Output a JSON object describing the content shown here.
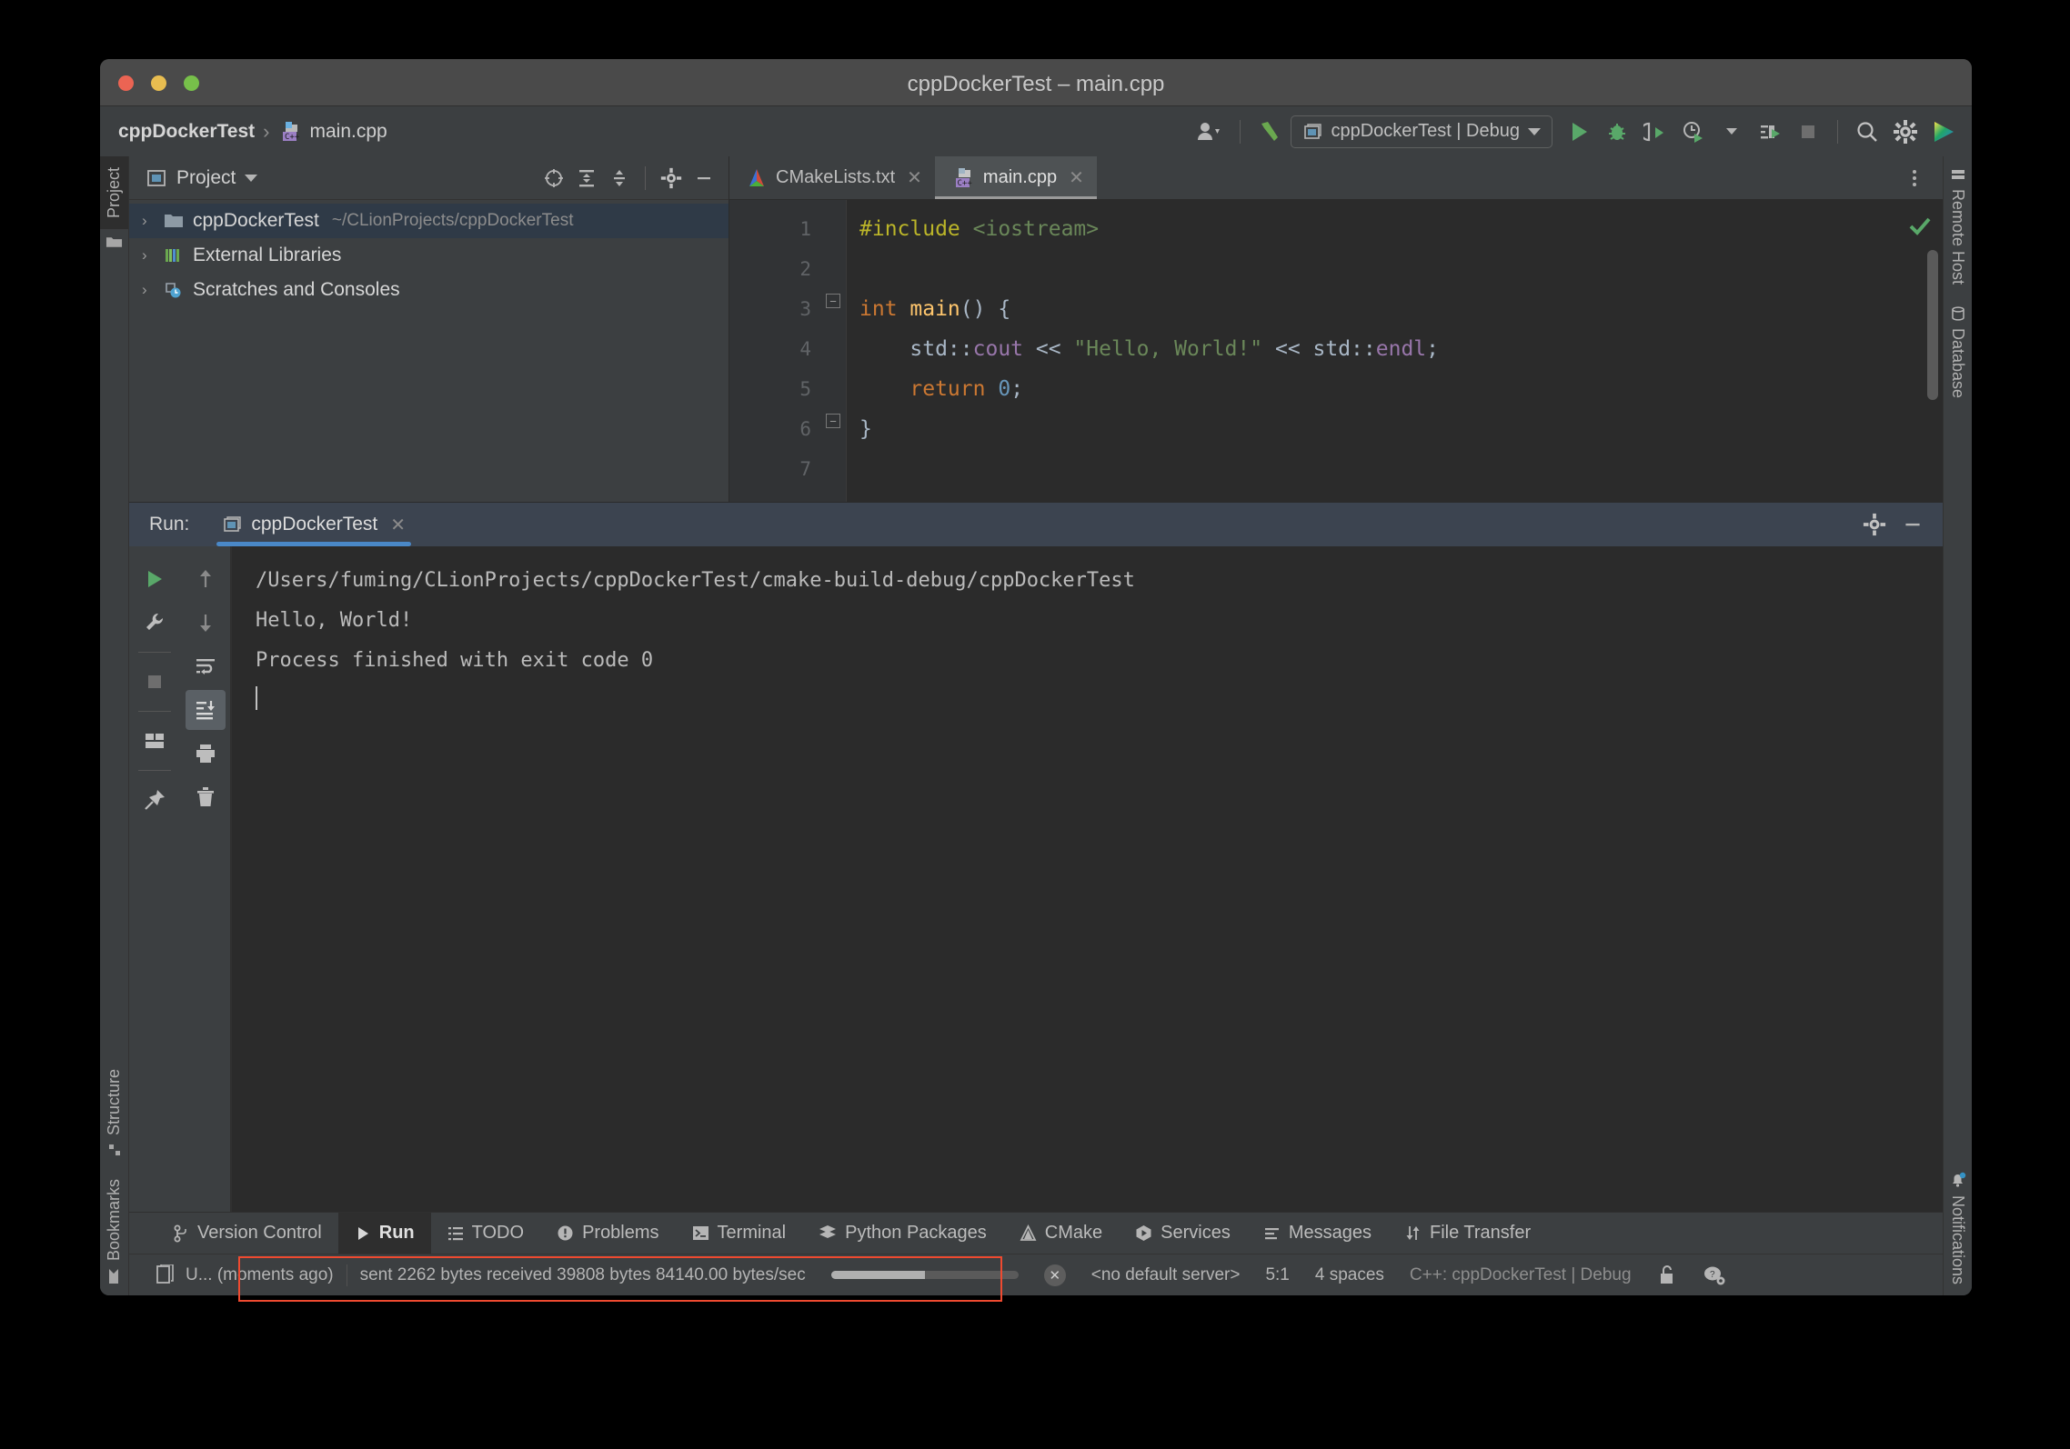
{
  "window": {
    "title": "cppDockerTest – main.cpp",
    "traffic_lights": [
      "close-red",
      "minimize-yellow",
      "maximize-green"
    ]
  },
  "navbar": {
    "breadcrumb": {
      "project": "cppDockerTest",
      "separator": "›",
      "file": "main.cpp"
    },
    "run_config": {
      "label": "cppDockerTest | Debug",
      "icon": "run-configuration-icon"
    },
    "buttons": [
      {
        "name": "user-account-icon",
        "label": ""
      },
      {
        "name": "build-hammer-icon",
        "label": ""
      },
      {
        "name": "run-icon",
        "label": ""
      },
      {
        "name": "debug-icon",
        "label": ""
      },
      {
        "name": "run-with-coverage-icon",
        "label": ""
      },
      {
        "name": "profile-icon",
        "label": ""
      },
      {
        "name": "attach-to-process-icon",
        "label": ""
      },
      {
        "name": "stop-icon",
        "label": ""
      },
      {
        "name": "search-icon",
        "label": ""
      },
      {
        "name": "settings-gear-icon",
        "label": ""
      },
      {
        "name": "ide-logo-icon",
        "label": ""
      }
    ]
  },
  "left_stripe": {
    "top": [
      {
        "label": "Project",
        "active": true
      }
    ],
    "bottom": [
      {
        "label": "Structure"
      },
      {
        "label": "Bookmarks"
      }
    ]
  },
  "right_stripe": {
    "top": [
      {
        "label": "Remote Host"
      },
      {
        "label": "Database"
      }
    ],
    "bottom": [
      {
        "label": "Notifications"
      }
    ]
  },
  "project_panel": {
    "title": "Project",
    "toolbar": [
      {
        "name": "select-opened-file-icon"
      },
      {
        "name": "expand-all-icon"
      },
      {
        "name": "collapse-all-icon"
      },
      {
        "name": "panel-settings-gear-icon"
      },
      {
        "name": "hide-panel-icon"
      }
    ],
    "tree": [
      {
        "label": "cppDockerTest",
        "path": "~/CLionProjects/cppDockerTest",
        "icon": "folder-icon",
        "selected": true,
        "expanded": false
      },
      {
        "label": "External Libraries",
        "path": "",
        "icon": "libraries-icon",
        "selected": false,
        "expanded": false
      },
      {
        "label": "Scratches and Consoles",
        "path": "",
        "icon": "scratches-icon",
        "selected": false,
        "expanded": false
      }
    ]
  },
  "editor": {
    "tabs": [
      {
        "label": "CMakeLists.txt",
        "icon": "cmake-icon",
        "active": false
      },
      {
        "label": "main.cpp",
        "icon": "cpp-file-icon",
        "active": true
      }
    ],
    "line_numbers": [
      "1",
      "2",
      "3",
      "4",
      "5",
      "6",
      "7"
    ],
    "code_lines": [
      {
        "n": 1,
        "tokens": [
          {
            "t": "#include",
            "c": "k-pre"
          },
          {
            "t": " ",
            "c": "k-txt"
          },
          {
            "t": "<iostream>",
            "c": "k-inc"
          }
        ]
      },
      {
        "n": 2,
        "tokens": []
      },
      {
        "n": 3,
        "tokens": [
          {
            "t": "int ",
            "c": "k-kw"
          },
          {
            "t": "main",
            "c": "k-fn"
          },
          {
            "t": "() {",
            "c": "k-txt"
          }
        ]
      },
      {
        "n": 4,
        "tokens": [
          {
            "t": "    std",
            "c": "k-txt"
          },
          {
            "t": "::",
            "c": "k-txt"
          },
          {
            "t": "cout",
            "c": "k-id"
          },
          {
            "t": " << ",
            "c": "k-txt"
          },
          {
            "t": "\"Hello, World!\"",
            "c": "k-str"
          },
          {
            "t": " << ",
            "c": "k-txt"
          },
          {
            "t": "std",
            "c": "k-txt"
          },
          {
            "t": "::",
            "c": "k-txt"
          },
          {
            "t": "endl",
            "c": "k-id"
          },
          {
            "t": ";",
            "c": "k-txt"
          }
        ]
      },
      {
        "n": 5,
        "tokens": [
          {
            "t": "    return ",
            "c": "k-kw"
          },
          {
            "t": "0",
            "c": "k-num"
          },
          {
            "t": ";",
            "c": "k-txt"
          }
        ]
      },
      {
        "n": 6,
        "tokens": [
          {
            "t": "}",
            "c": "k-txt"
          }
        ]
      },
      {
        "n": 7,
        "tokens": []
      }
    ],
    "inspection_status": "ok-checkmark"
  },
  "run_window": {
    "label": "Run:",
    "tab": {
      "label": "cppDockerTest",
      "icon": "run-config-icon"
    },
    "header_buttons": [
      {
        "name": "run-settings-gear-icon"
      },
      {
        "name": "hide-run-panel-icon"
      }
    ],
    "side_buttons_left": [
      {
        "name": "rerun-icon",
        "selected": false
      },
      {
        "name": "wrench-settings-icon",
        "selected": false
      },
      {
        "name": "stop-process-icon",
        "selected": false
      },
      {
        "name": "layout-icon",
        "selected": false
      },
      {
        "name": "pin-tab-icon",
        "selected": false
      }
    ],
    "side_buttons_right": [
      {
        "name": "up-arrow-icon",
        "selected": false
      },
      {
        "name": "down-arrow-icon",
        "selected": false
      },
      {
        "name": "soft-wrap-icon",
        "selected": false
      },
      {
        "name": "scroll-to-end-icon",
        "selected": true
      },
      {
        "name": "print-icon",
        "selected": false
      },
      {
        "name": "clear-all-trash-icon",
        "selected": false
      }
    ],
    "console_lines": [
      "/Users/fuming/CLionProjects/cppDockerTest/cmake-build-debug/cppDockerTest",
      "Hello, World!",
      "",
      "Process finished with exit code 0"
    ]
  },
  "bottom_bar": {
    "tabs": [
      {
        "label": "Version Control",
        "icon": "branch-icon",
        "active": false
      },
      {
        "label": "Run",
        "icon": "run-triangle-icon",
        "active": true
      },
      {
        "label": "TODO",
        "icon": "todo-list-icon",
        "active": false
      },
      {
        "label": "Problems",
        "icon": "problems-icon",
        "active": false
      },
      {
        "label": "Terminal",
        "icon": "terminal-icon",
        "active": false
      },
      {
        "label": "Python Packages",
        "icon": "python-packages-icon",
        "active": false
      },
      {
        "label": "CMake",
        "icon": "cmake-icon",
        "active": false
      },
      {
        "label": "Services",
        "icon": "services-icon",
        "active": false
      },
      {
        "label": "Messages",
        "icon": "messages-icon",
        "active": false
      },
      {
        "label": "File Transfer",
        "icon": "file-transfer-icon",
        "active": false
      }
    ]
  },
  "status_bar": {
    "update_text": "U... (moments ago)",
    "transfer_text": "sent 2262 bytes  received 39808 bytes  84140.00 bytes/sec",
    "progress_percent": 50,
    "cancel_icon": "cancel-circle-x-icon",
    "default_server": "<no default server>",
    "caret_position": "5:1",
    "indent": "4 spaces",
    "language_config": "C++: cppDockerTest | Debug",
    "lock_icon": "unlocked-padlock-icon",
    "help_icon": "help-settings-icon"
  },
  "annotation": {
    "highlight_color": "#ef4a30"
  }
}
